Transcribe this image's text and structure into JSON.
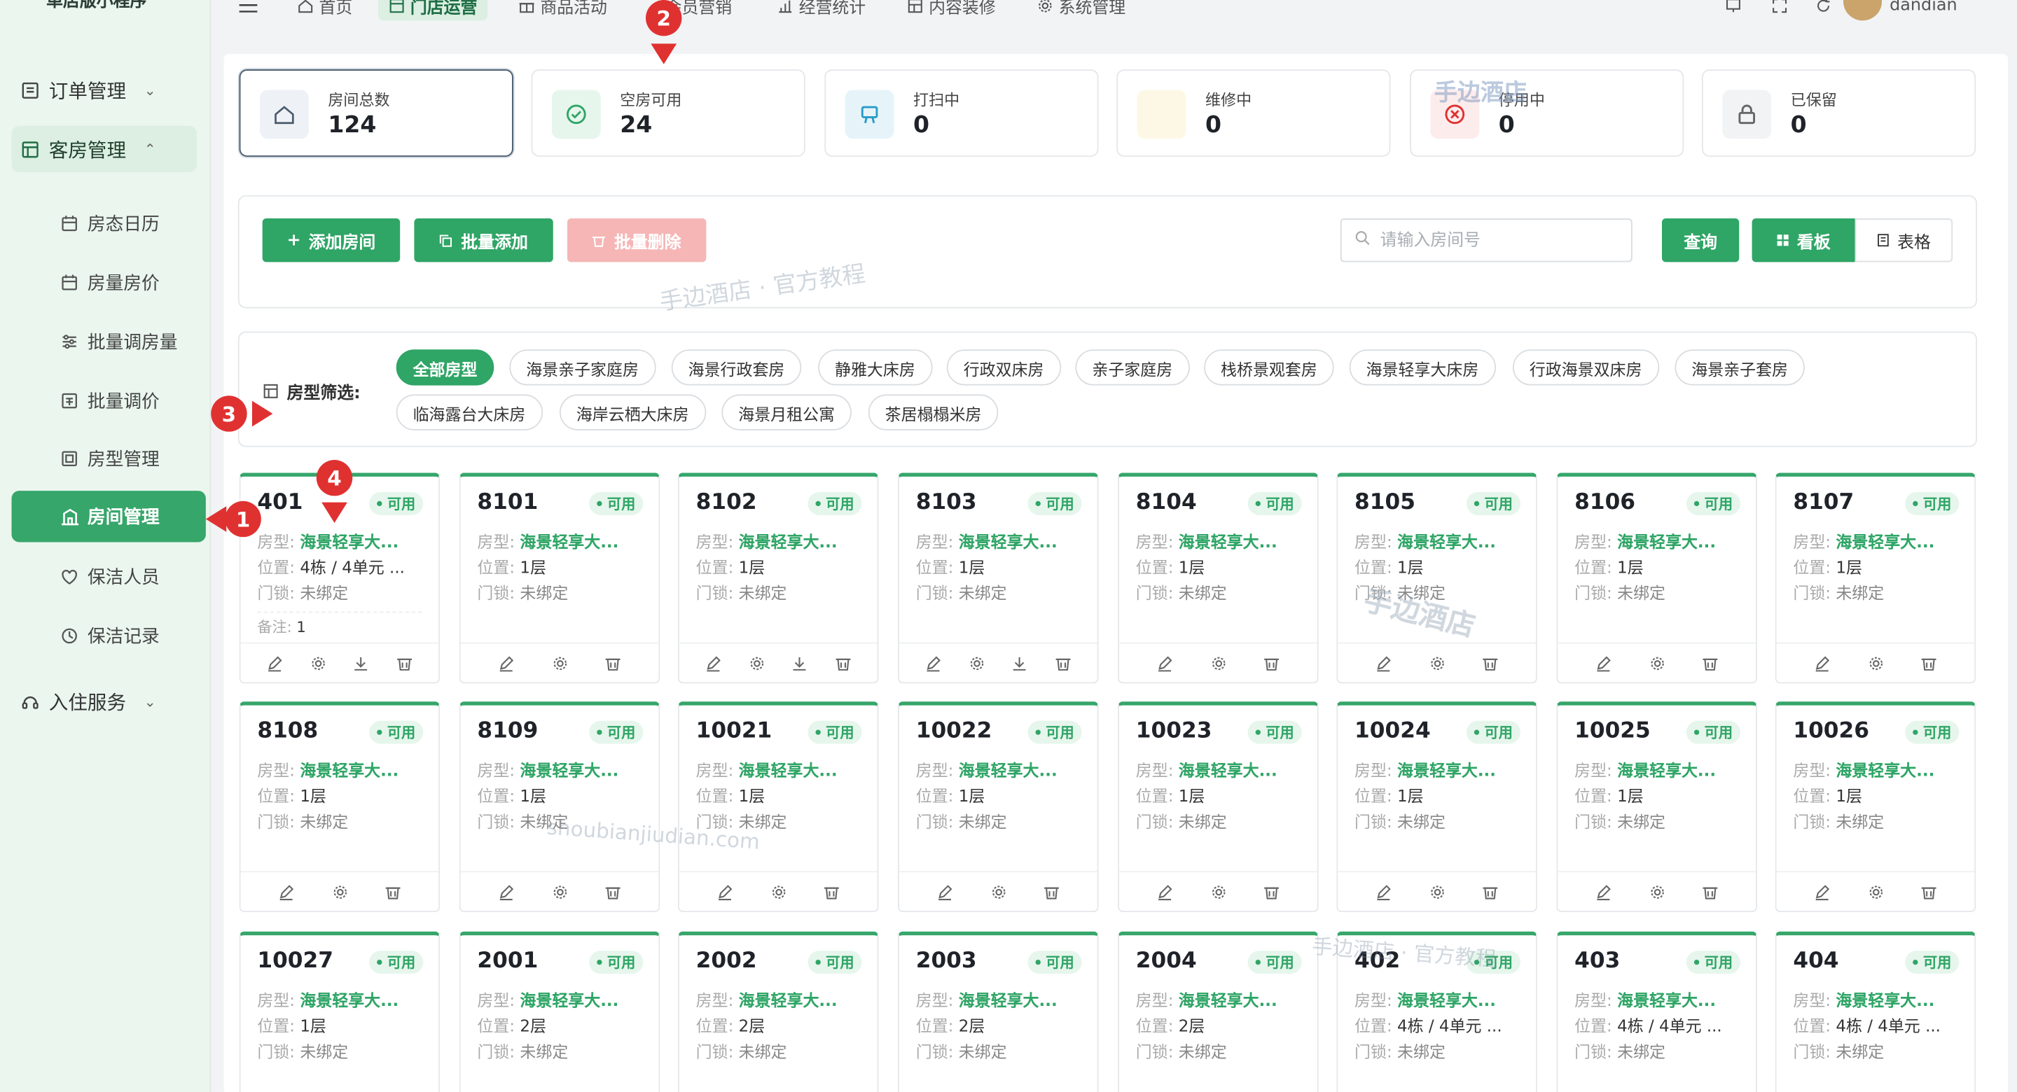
{
  "sidebar": {
    "brand": "单店版小程序",
    "groups": [
      {
        "label": "订单管理",
        "icon": "order-icon"
      },
      {
        "label": "客房管理",
        "icon": "room-icon"
      },
      {
        "label": "入住服务",
        "icon": "service-icon"
      }
    ],
    "subs": [
      {
        "label": "房态日历",
        "icon": "calendar-icon"
      },
      {
        "label": "房量房价",
        "icon": "calendar-price-icon"
      },
      {
        "label": "批量调房量",
        "icon": "sliders-icon"
      },
      {
        "label": "批量调价",
        "icon": "price-icon"
      },
      {
        "label": "房型管理",
        "icon": "room-type-icon"
      },
      {
        "label": "房间管理",
        "icon": "building-icon"
      },
      {
        "label": "保洁人员",
        "icon": "cleaner-icon"
      },
      {
        "label": "保洁记录",
        "icon": "history-icon"
      }
    ]
  },
  "topnav": {
    "items": [
      "首页",
      "门店运营",
      "商品活动",
      "会员营销",
      "经营统计",
      "内容装修",
      "系统管理"
    ],
    "username": "dandian"
  },
  "stats": [
    {
      "label": "房间总数",
      "value": "124",
      "icon": "home-icon",
      "color": "#eef2f6"
    },
    {
      "label": "空房可用",
      "value": "24",
      "icon": "check-circle-icon",
      "color": "#e6f6ec"
    },
    {
      "label": "打扫中",
      "value": "0",
      "icon": "broom-icon",
      "color": "#e6f4fa"
    },
    {
      "label": "维修中",
      "value": "0",
      "icon": "wrench-icon",
      "color": "#fdf8e6"
    },
    {
      "label": "停用中",
      "value": "0",
      "icon": "close-circle-icon",
      "color": "#fdecec"
    },
    {
      "label": "已保留",
      "value": "0",
      "icon": "lock-icon",
      "color": "#f2f3f5"
    }
  ],
  "toolbar": {
    "add_label": "添加房间",
    "batch_add_label": "批量添加",
    "batch_delete_label": "批量删除",
    "search_placeholder": "请输入房间号",
    "query_label": "查询",
    "board_label": "看板",
    "table_label": "表格"
  },
  "filter": {
    "label": "房型筛选:",
    "chips": [
      "全部房型",
      "海景亲子家庭房",
      "海景行政套房",
      "静雅大床房",
      "行政双床房",
      "亲子家庭房",
      "栈桥景观套房",
      "海景轻享大床房",
      "行政海景双床房",
      "海景亲子套房",
      "临海露台大床房",
      "海岸云栖大床房",
      "海景月租公寓",
      "茶居榻榻米房"
    ]
  },
  "card_labels": {
    "type": "房型:",
    "location": "位置:",
    "lock": "门锁:",
    "note": "备注:"
  },
  "rooms": [
    {
      "num": "401",
      "status": "可用",
      "type": "海景轻享大...",
      "location": "4栋 / 4单元 ...",
      "lock": "未绑定",
      "note": "1",
      "extra": true
    },
    {
      "num": "8101",
      "status": "可用",
      "type": "海景轻享大...",
      "location": "1层",
      "lock": "未绑定",
      "extra": false
    },
    {
      "num": "8102",
      "status": "可用",
      "type": "海景轻享大...",
      "location": "1层",
      "lock": "未绑定",
      "extra": true
    },
    {
      "num": "8103",
      "status": "可用",
      "type": "海景轻享大...",
      "location": "1层",
      "lock": "未绑定",
      "extra": true
    },
    {
      "num": "8104",
      "status": "可用",
      "type": "海景轻享大...",
      "location": "1层",
      "lock": "未绑定",
      "extra": false
    },
    {
      "num": "8105",
      "status": "可用",
      "type": "海景轻享大...",
      "location": "1层",
      "lock": "未绑定",
      "extra": false
    },
    {
      "num": "8106",
      "status": "可用",
      "type": "海景轻享大...",
      "location": "1层",
      "lock": "未绑定",
      "extra": false
    },
    {
      "num": "8107",
      "status": "可用",
      "type": "海景轻享大...",
      "location": "1层",
      "lock": "未绑定",
      "extra": false
    },
    {
      "num": "8108",
      "status": "可用",
      "type": "海景轻享大...",
      "location": "1层",
      "lock": "未绑定",
      "extra": false
    },
    {
      "num": "8109",
      "status": "可用",
      "type": "海景轻享大...",
      "location": "1层",
      "lock": "未绑定",
      "extra": false
    },
    {
      "num": "10021",
      "status": "可用",
      "type": "海景轻享大...",
      "location": "1层",
      "lock": "未绑定",
      "extra": false
    },
    {
      "num": "10022",
      "status": "可用",
      "type": "海景轻享大...",
      "location": "1层",
      "lock": "未绑定",
      "extra": false
    },
    {
      "num": "10023",
      "status": "可用",
      "type": "海景轻享大...",
      "location": "1层",
      "lock": "未绑定",
      "extra": false
    },
    {
      "num": "10024",
      "status": "可用",
      "type": "海景轻享大...",
      "location": "1层",
      "lock": "未绑定",
      "extra": false
    },
    {
      "num": "10025",
      "status": "可用",
      "type": "海景轻享大...",
      "location": "1层",
      "lock": "未绑定",
      "extra": false
    },
    {
      "num": "10026",
      "status": "可用",
      "type": "海景轻享大...",
      "location": "1层",
      "lock": "未绑定",
      "extra": false
    },
    {
      "num": "10027",
      "status": "可用",
      "type": "海景轻享大...",
      "location": "1层",
      "lock": "未绑定",
      "extra": false
    },
    {
      "num": "2001",
      "status": "可用",
      "type": "海景轻享大...",
      "location": "2层",
      "lock": "未绑定",
      "extra": false
    },
    {
      "num": "2002",
      "status": "可用",
      "type": "海景轻享大...",
      "location": "2层",
      "lock": "未绑定",
      "extra": false
    },
    {
      "num": "2003",
      "status": "可用",
      "type": "海景轻享大...",
      "location": "2层",
      "lock": "未绑定",
      "extra": false
    },
    {
      "num": "2004",
      "status": "可用",
      "type": "海景轻享大...",
      "location": "2层",
      "lock": "未绑定",
      "extra": false
    },
    {
      "num": "402",
      "status": "可用",
      "type": "海景轻享大...",
      "location": "4栋 / 4单元 ...",
      "lock": "未绑定",
      "extra": false
    },
    {
      "num": "403",
      "status": "可用",
      "type": "海景轻享大...",
      "location": "4栋 / 4单元 ...",
      "lock": "未绑定",
      "extra": false
    },
    {
      "num": "404",
      "status": "可用",
      "type": "海景轻享大...",
      "location": "4栋 / 4单元 ...",
      "lock": "未绑定",
      "extra": false
    }
  ],
  "annotations": [
    "1",
    "2",
    "3",
    "4"
  ],
  "watermarks": [
    "手边酒店",
    "手边酒店 · 官方教程",
    "手边酒店",
    "shoubianjiudian.com",
    "手边酒店 · 官方教程"
  ],
  "colors": {
    "accent": "#2fa566",
    "danger": "#e03131",
    "sidebar_bg": "#eaf6ee"
  }
}
